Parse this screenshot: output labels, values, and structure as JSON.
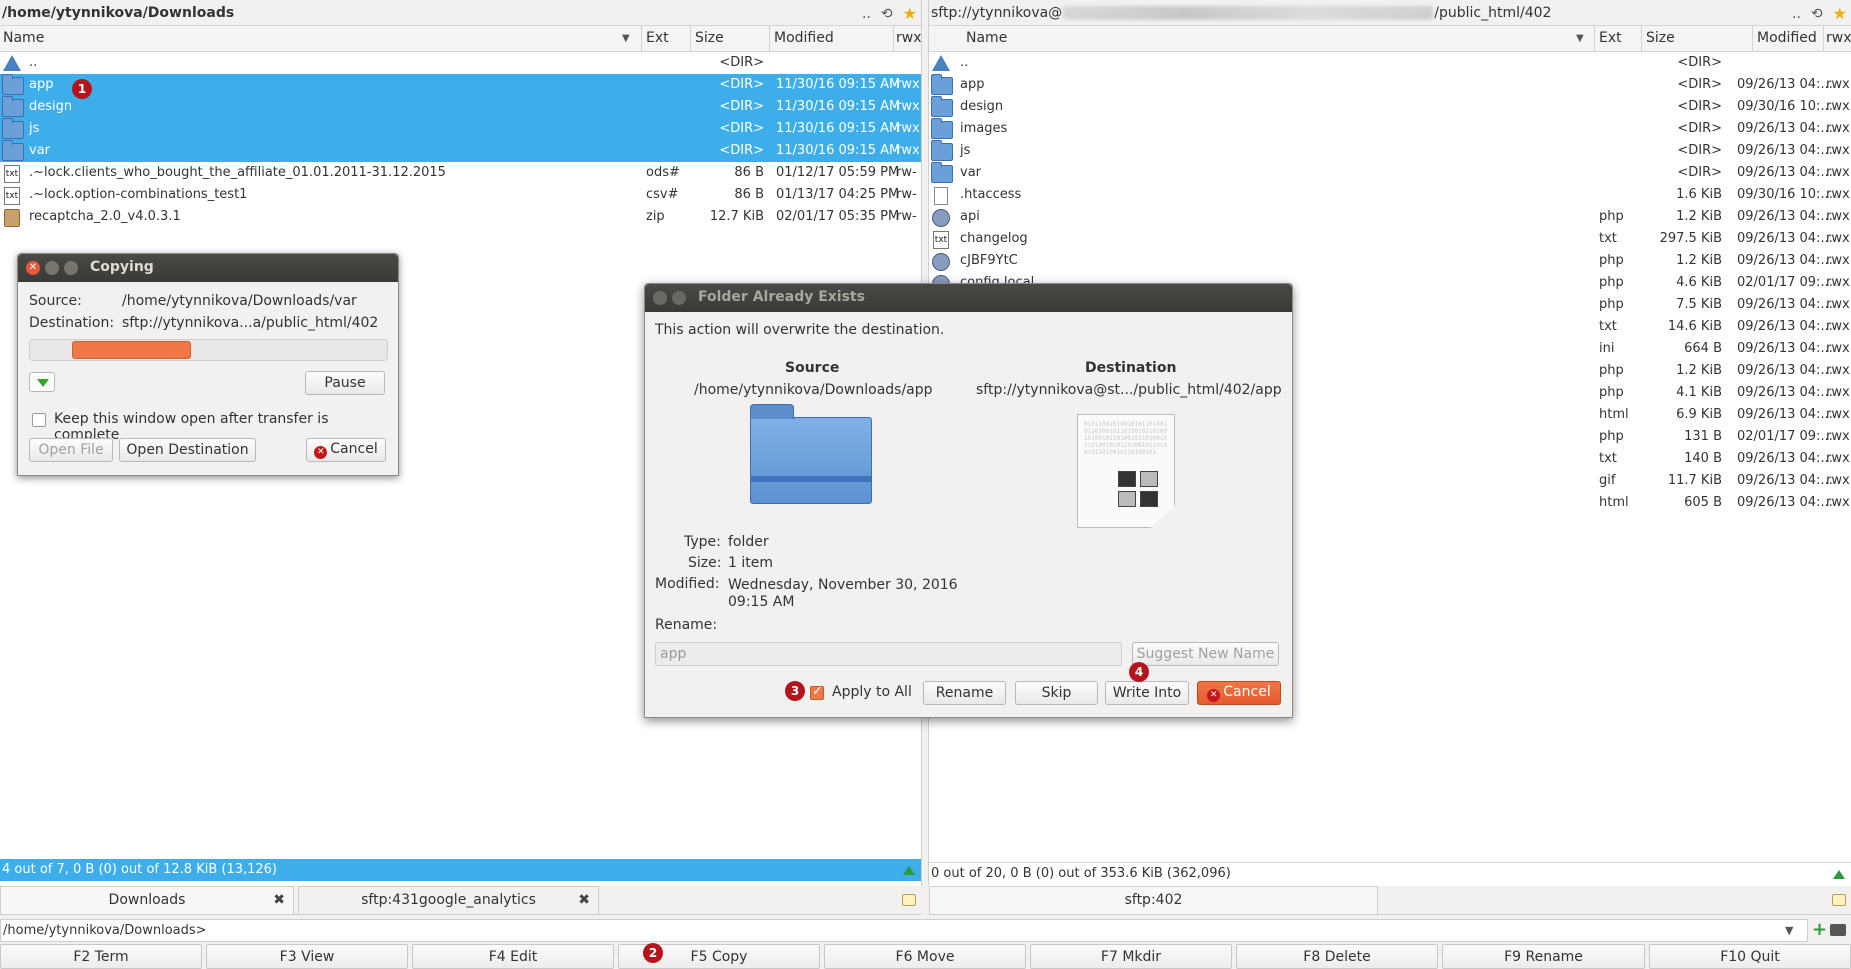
{
  "left_panel": {
    "path": "/home/ytynnikova/Downloads",
    "path_tools": [
      ".."
    ],
    "columns": [
      "Name",
      "Ext",
      "Size",
      "Modified",
      "rwx"
    ],
    "rows": [
      {
        "name": "..",
        "ext": "",
        "size": "<DIR>",
        "modified": "",
        "rwx": "",
        "icon": "up-arrow-icon",
        "selected": false
      },
      {
        "name": "app",
        "ext": "",
        "size": "<DIR>",
        "modified": "11/30/16 09:15 AM",
        "rwx": "rwx",
        "icon": "folder-icon",
        "selected": true
      },
      {
        "name": "design",
        "ext": "",
        "size": "<DIR>",
        "modified": "11/30/16 09:15 AM",
        "rwx": "rwx",
        "icon": "folder-icon",
        "selected": true
      },
      {
        "name": "js",
        "ext": "",
        "size": "<DIR>",
        "modified": "11/30/16 09:15 AM",
        "rwx": "rwx",
        "icon": "folder-icon",
        "selected": true
      },
      {
        "name": "var",
        "ext": "",
        "size": "<DIR>",
        "modified": "11/30/16 09:15 AM",
        "rwx": "rwx",
        "icon": "folder-icon",
        "selected": true
      },
      {
        "name": ".~lock.clients_who_bought_the_affiliate_01.01.2011-31.12.2015",
        "ext": "ods#",
        "size": "86 B",
        "modified": "01/12/17 05:59 PM",
        "rwx": "rw-",
        "icon": "text-file-icon",
        "selected": false
      },
      {
        "name": ".~lock.option-combinations_test1",
        "ext": "csv#",
        "size": "86 B",
        "modified": "01/13/17 04:25 PM",
        "rwx": "rw-",
        "icon": "text-file-icon",
        "selected": false
      },
      {
        "name": "recaptcha_2.0_v4.0.3.1",
        "ext": "zip",
        "size": "12.7 KiB",
        "modified": "02/01/17 05:35 PM",
        "rwx": "rw-",
        "icon": "archive-icon",
        "selected": false
      }
    ],
    "status": "4 out of 7, 0 B (0) out of 12.8 KiB (13,126)",
    "tabs": [
      {
        "label": "Downloads",
        "active": true
      },
      {
        "label": "sftp:431google_analytics",
        "active": false
      }
    ]
  },
  "right_panel": {
    "path_prefix": "sftp://ytynnikova@",
    "path_suffix": "/public_html/402",
    "columns": [
      "Name",
      "Ext",
      "Size",
      "Modified",
      "rwx"
    ],
    "rows": [
      {
        "name": "..",
        "ext": "",
        "size": "<DIR>",
        "modified": "",
        "rwx": "",
        "icon": "up-arrow-icon"
      },
      {
        "name": "app",
        "ext": "",
        "size": "<DIR>",
        "modified": "09/26/13 04:...",
        "rwx": "rwx",
        "icon": "folder-icon"
      },
      {
        "name": "design",
        "ext": "",
        "size": "<DIR>",
        "modified": "09/30/16 10:...",
        "rwx": "rwx",
        "icon": "folder-icon"
      },
      {
        "name": "images",
        "ext": "",
        "size": "<DIR>",
        "modified": "09/26/13 04:...",
        "rwx": "rwx",
        "icon": "folder-icon"
      },
      {
        "name": "js",
        "ext": "",
        "size": "<DIR>",
        "modified": "09/26/13 04:...",
        "rwx": "rwx",
        "icon": "folder-icon"
      },
      {
        "name": "var",
        "ext": "",
        "size": "<DIR>",
        "modified": "09/26/13 04:...",
        "rwx": "rwx",
        "icon": "folder-icon"
      },
      {
        "name": ".htaccess",
        "ext": "",
        "size": "1.6 KiB",
        "modified": "09/30/16 10:...",
        "rwx": "rwx",
        "icon": "file-icon"
      },
      {
        "name": "api",
        "ext": "php",
        "size": "1.2 KiB",
        "modified": "09/26/13 04:...",
        "rwx": "rwx",
        "icon": "php-file-icon"
      },
      {
        "name": "changelog",
        "ext": "txt",
        "size": "297.5 KiB",
        "modified": "09/26/13 04:...",
        "rwx": "rwx",
        "icon": "text-file-icon"
      },
      {
        "name": "cJBF9YtC",
        "ext": "php",
        "size": "1.2 KiB",
        "modified": "09/26/13 04:...",
        "rwx": "rwx",
        "icon": "php-file-icon"
      },
      {
        "name": "config.local",
        "ext": "php",
        "size": "4.6 KiB",
        "modified": "02/01/17 09:...",
        "rwx": "rwx",
        "icon": "php-file-icon"
      },
      {
        "name": "",
        "ext": "php",
        "size": "7.5 KiB",
        "modified": "09/26/13 04:...",
        "rwx": "rwx",
        "icon": ""
      },
      {
        "name": "",
        "ext": "txt",
        "size": "14.6 KiB",
        "modified": "09/26/13 04:...",
        "rwx": "rwx",
        "icon": ""
      },
      {
        "name": "",
        "ext": "ini",
        "size": "664 B",
        "modified": "09/26/13 04:...",
        "rwx": "rwx",
        "icon": ""
      },
      {
        "name": "",
        "ext": "php",
        "size": "1.2 KiB",
        "modified": "09/26/13 04:...",
        "rwx": "rwx",
        "icon": ""
      },
      {
        "name": "",
        "ext": "php",
        "size": "4.1 KiB",
        "modified": "09/26/13 04:...",
        "rwx": "rwx",
        "icon": ""
      },
      {
        "name": "",
        "ext": "html",
        "size": "6.9 KiB",
        "modified": "09/26/13 04:...",
        "rwx": "rwx",
        "icon": ""
      },
      {
        "name": "",
        "ext": "php",
        "size": "131 B",
        "modified": "02/01/17 09:...",
        "rwx": "rwx",
        "icon": ""
      },
      {
        "name": "",
        "ext": "txt",
        "size": "140 B",
        "modified": "09/26/13 04:...",
        "rwx": "rwx",
        "icon": ""
      },
      {
        "name": "",
        "ext": "gif",
        "size": "11.7 KiB",
        "modified": "09/26/13 04:...",
        "rwx": "rwx",
        "icon": ""
      },
      {
        "name": "",
        "ext": "html",
        "size": "605 B",
        "modified": "09/26/13 04:...",
        "rwx": "rwx",
        "icon": ""
      }
    ],
    "status": "0 out of 20, 0 B (0) out of 353.6 KiB (362,096)",
    "tabs": [
      {
        "label": "sftp:402",
        "active": true
      }
    ]
  },
  "cmdline": {
    "value": "/home/ytynnikova/Downloads>"
  },
  "fkeys": [
    "F2 Term",
    "F3 View",
    "F4 Edit",
    "F5 Copy",
    "F6 Move",
    "F7 Mkdir",
    "F8 Delete",
    "F9 Rename",
    "F10 Quit"
  ],
  "badges": [
    "1",
    "2",
    "3",
    "4"
  ],
  "copy_dialog": {
    "title": "Copying",
    "source_label": "Source:",
    "source": "/home/ytynnikova/Downloads/var",
    "destination_label": "Destination:",
    "destination": "sftp://ytynnikova...a/public_html/402",
    "progress": 0.33,
    "pause": "Pause",
    "keep_open": "Keep this window open after transfer is complete",
    "keep_open_checked": false,
    "open_file": "Open File",
    "open_destination": "Open Destination",
    "cancel": "Cancel"
  },
  "exists_dialog": {
    "title": "Folder Already Exists",
    "message": "This action will overwrite the destination.",
    "source_heading": "Source",
    "source_path": "/home/ytynnikova/Downloads/app",
    "destination_heading": "Destination",
    "destination_path": "sftp://ytynnikova@st.../public_html/402/app",
    "type_label": "Type:",
    "type": "folder",
    "size_label": "Size:",
    "size": "1 item",
    "modified_label": "Modified:",
    "modified_line1": "Wednesday, November 30, 2016",
    "modified_line2": "09:15 AM",
    "rename_label": "Rename:",
    "rename_value": "app",
    "suggest": "Suggest New Name",
    "apply_all": "Apply to All",
    "apply_all_checked": true,
    "rename": "Rename",
    "skip": "Skip",
    "write_into": "Write Into",
    "cancel": "Cancel"
  },
  "colors": {
    "selection": "#3daee9",
    "accent": "#f07746",
    "badge": "#b5141c",
    "titlebar": "#3b3a36"
  }
}
